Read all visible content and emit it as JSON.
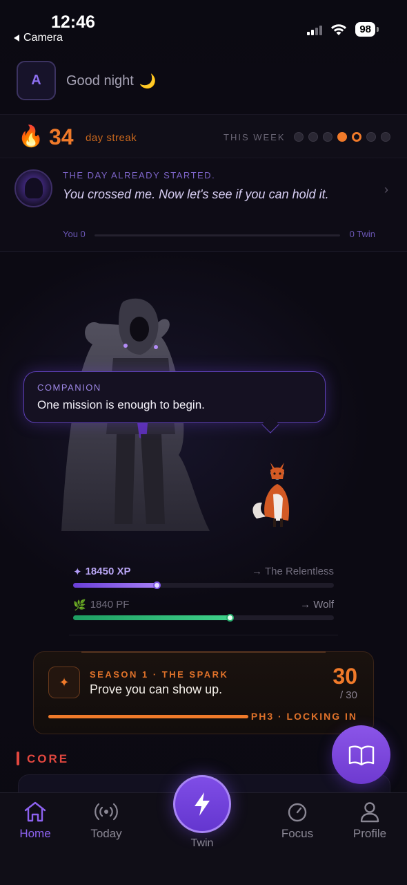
{
  "status_bar": {
    "time": "12:46",
    "back_label": "Camera",
    "battery": "98"
  },
  "header": {
    "avatar_letter": "A",
    "greeting": "Good night",
    "greeting_emoji": "🌙"
  },
  "streak": {
    "count": "34",
    "label": "day streak",
    "week_label": "THIS WEEK",
    "days": [
      "empty",
      "empty",
      "empty",
      "done",
      "today",
      "empty",
      "empty"
    ],
    "accent": "#f07a2a"
  },
  "rival": {
    "kicker": "THE DAY ALREADY STARTED.",
    "quote": "You crossed me. Now let's see if you can hold it.",
    "you_score": "You 0",
    "twin_score": "0 Twin"
  },
  "companion": {
    "kicker": "COMPANION",
    "message": "One mission is enough to begin."
  },
  "progress": {
    "xp_label": "18450 XP",
    "xp_next": "→ The Relentless",
    "xp_fraction": 0.32,
    "pf_label": "1840 PF",
    "pf_next": "→ Wolf",
    "pf_fraction": 0.6
  },
  "season": {
    "kicker": "SEASON 1 · THE SPARK",
    "title": "Prove you can show up.",
    "current": "30",
    "total": "/ 30",
    "fraction": 1.0,
    "phase": "PH3 · LOCKING IN"
  },
  "core": {
    "label": "CORE"
  },
  "tabs": [
    {
      "id": "home",
      "label": "Home",
      "icon": "home-icon",
      "active": true
    },
    {
      "id": "today",
      "label": "Today",
      "icon": "broadcast-icon",
      "active": false
    },
    {
      "id": "twin",
      "label": "Twin",
      "icon": "bolt-icon",
      "active": false
    },
    {
      "id": "focus",
      "label": "Focus",
      "icon": "timer-icon",
      "active": false
    },
    {
      "id": "profile",
      "label": "Profile",
      "icon": "person-icon",
      "active": false
    }
  ],
  "colors": {
    "brand_purple": "#7b4fe0",
    "streak_orange": "#f07a2a",
    "core_red": "#e2473f",
    "pf_green": "#3fd18a"
  }
}
